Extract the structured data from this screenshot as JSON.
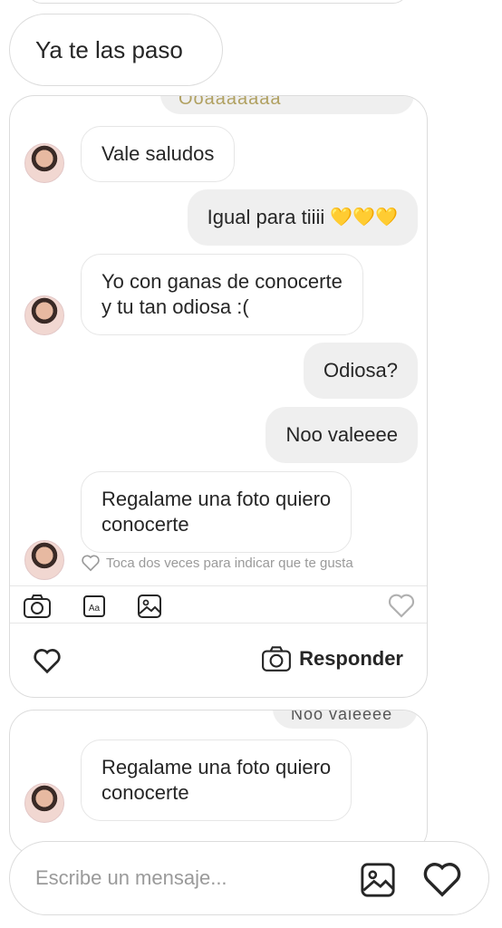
{
  "thread": {
    "top_incoming": "Ya te las paso"
  },
  "story_card": {
    "cut_off_text": "Ooaaaaaaa",
    "messages": [
      {
        "from": "them",
        "text": "Vale saludos"
      },
      {
        "from": "me",
        "text": "Igual para tiiii",
        "emoji": "💛💛💛"
      },
      {
        "from": "them",
        "line1": "Yo con ganas de conocerte",
        "line2": "y tu tan odiosa :("
      },
      {
        "from": "me",
        "text": "Odiosa?"
      },
      {
        "from": "me",
        "text": "Noo valeeee"
      },
      {
        "from": "them",
        "line1": "Regalame una foto quiero",
        "line2": "conocerte"
      }
    ],
    "like_hint": "Toca dos veces para indicar que te gusta",
    "reply_label": "Responder"
  },
  "story_card2": {
    "cut_off_text": "Noo valeeee",
    "message": {
      "line1": "Regalame una foto quiero",
      "line2": "conocerte"
    }
  },
  "composer": {
    "placeholder": "Escribe un mensaje..."
  },
  "colors": {
    "outgoing_bubble": "#efefef",
    "incoming_border": "#e6e6e6",
    "heart_emoji": "#f5b800"
  },
  "icons": [
    "camera-icon",
    "text-mode-icon",
    "gallery-icon",
    "heart-icon",
    "image-icon"
  ]
}
